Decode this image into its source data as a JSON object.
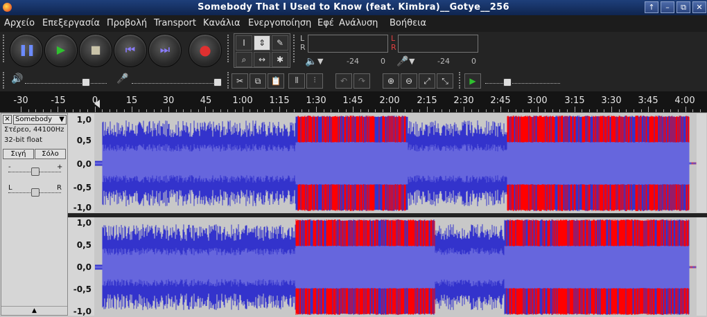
{
  "window": {
    "title": "Somebody That I Used to Know (feat. Kimbra)__Gotye__256",
    "buttons": [
      "↑",
      "–",
      "⧉",
      "✕"
    ]
  },
  "menu": [
    "Αρχείο",
    "Επεξεργασία",
    "Προβολή",
    "Transport",
    "Κανάλια",
    "Ενεργοποίηση",
    "Εφέ",
    "Ανάλυση",
    "Βοήθεια"
  ],
  "transport": {
    "pause": "pause-icon",
    "play": "play-icon",
    "stop": "stop-icon",
    "skip_start": "skip-start-icon",
    "skip_end": "skip-end-icon",
    "record": "record-icon"
  },
  "meters": {
    "L": "L",
    "R": "R",
    "db_play_left": "-24",
    "db_play_zero": "0",
    "db_rec_left": "-24",
    "db_rec_zero": "0"
  },
  "ruler": {
    "labels": [
      "-30",
      "-15",
      "0",
      "15",
      "30",
      "45",
      "1:00",
      "1:15",
      "1:30",
      "1:45",
      "2:00",
      "2:15",
      "2:30",
      "2:45",
      "3:00",
      "3:15",
      "3:30",
      "3:45",
      "4:00"
    ]
  },
  "track": {
    "name": "Somebody",
    "format": "Στέρεο, 44100Hz",
    "bitdepth": "32-bit float",
    "mute": "Σιγή",
    "solo": "Σόλο",
    "gain_minus": "-",
    "gain_plus": "+",
    "pan_left": "L",
    "pan_right": "R",
    "gain_level": 0.5,
    "pan_level": 0.5
  },
  "scale": {
    "labels": [
      "1,0",
      "0,5",
      "0,0",
      "-0,5",
      "-1,0"
    ]
  },
  "colors": {
    "wave": "#3333cc",
    "wave_rms": "#6666dd",
    "clip": "#ff0000",
    "background": "#c8c8c8"
  },
  "clipping": {
    "channel_top": [
      [
        0.334,
        0.52
      ],
      [
        0.685,
        1.0
      ]
    ],
    "channel_bottom": [
      [
        0.334,
        0.565
      ],
      [
        0.68,
        1.0
      ]
    ]
  }
}
